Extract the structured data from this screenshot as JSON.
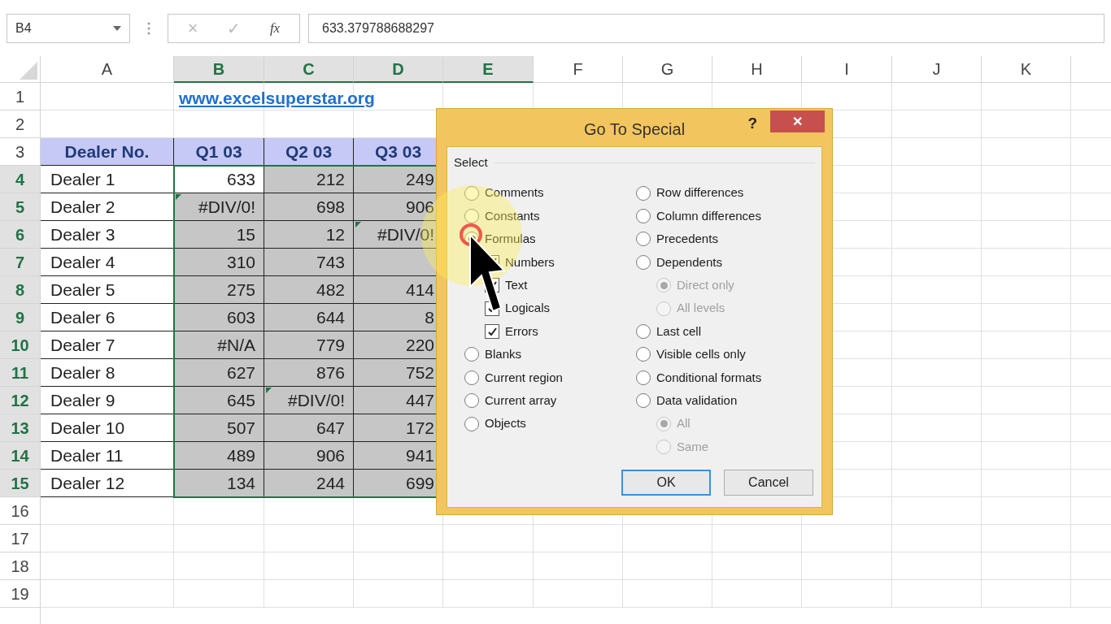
{
  "formula_bar": {
    "name_box": "B4",
    "cancel_icon": "×",
    "enter_icon": "✓",
    "function_icon": "fx",
    "formula": "633.379788688297"
  },
  "column_headers": [
    {
      "label": "A",
      "selected": false
    },
    {
      "label": "B",
      "selected": true
    },
    {
      "label": "C",
      "selected": true
    },
    {
      "label": "D",
      "selected": true
    },
    {
      "label": "E",
      "selected": true
    },
    {
      "label": "F",
      "selected": false
    },
    {
      "label": "G",
      "selected": false
    },
    {
      "label": "H",
      "selected": false
    },
    {
      "label": "I",
      "selected": false
    },
    {
      "label": "J",
      "selected": false
    },
    {
      "label": "K",
      "selected": false
    }
  ],
  "row_headers": [
    {
      "label": "1",
      "selected": false
    },
    {
      "label": "2",
      "selected": false
    },
    {
      "label": "3",
      "selected": false
    },
    {
      "label": "4",
      "selected": true
    },
    {
      "label": "5",
      "selected": true
    },
    {
      "label": "6",
      "selected": true
    },
    {
      "label": "7",
      "selected": true
    },
    {
      "label": "8",
      "selected": true
    },
    {
      "label": "9",
      "selected": true
    },
    {
      "label": "10",
      "selected": true
    },
    {
      "label": "11",
      "selected": true
    },
    {
      "label": "12",
      "selected": true
    },
    {
      "label": "13",
      "selected": true
    },
    {
      "label": "14",
      "selected": true
    },
    {
      "label": "15",
      "selected": true
    },
    {
      "label": "16",
      "selected": false
    },
    {
      "label": "17",
      "selected": false
    },
    {
      "label": "18",
      "selected": false
    },
    {
      "label": "19",
      "selected": false
    }
  ],
  "link": "www.excelsuperstar.org",
  "table": {
    "columns": [
      "Dealer No.",
      "Q1 03",
      "Q2 03",
      "Q3 03"
    ],
    "rows": [
      {
        "dealer": "Dealer 1",
        "values": [
          {
            "text": "633",
            "selected": false,
            "error_flag": false
          },
          {
            "text": "212",
            "selected": true,
            "error_flag": false
          },
          {
            "text": "249",
            "selected": true,
            "error_flag": false
          }
        ]
      },
      {
        "dealer": "Dealer 2",
        "values": [
          {
            "text": "#DIV/0!",
            "selected": true,
            "error_flag": true
          },
          {
            "text": "698",
            "selected": true,
            "error_flag": false
          },
          {
            "text": "906",
            "selected": true,
            "error_flag": false
          }
        ]
      },
      {
        "dealer": "Dealer 3",
        "values": [
          {
            "text": "15",
            "selected": true,
            "error_flag": false
          },
          {
            "text": "12",
            "selected": true,
            "error_flag": false
          },
          {
            "text": "#DIV/0!",
            "selected": true,
            "error_flag": true
          }
        ]
      },
      {
        "dealer": "Dealer 4",
        "values": [
          {
            "text": "310",
            "selected": true,
            "error_flag": false
          },
          {
            "text": "743",
            "selected": true,
            "error_flag": false
          },
          {
            "selected": true,
            "error_flag": false
          }
        ]
      },
      {
        "dealer": "Dealer 5",
        "values": [
          {
            "text": "275",
            "selected": true,
            "error_flag": false
          },
          {
            "text": "482",
            "selected": true,
            "error_flag": false
          },
          {
            "text": "414",
            "selected": true,
            "error_flag": false
          }
        ]
      },
      {
        "dealer": "Dealer 6",
        "values": [
          {
            "text": "603",
            "selected": true,
            "error_flag": false
          },
          {
            "text": "644",
            "selected": true,
            "error_flag": false
          },
          {
            "text": "8",
            "selected": true,
            "error_flag": false
          }
        ]
      },
      {
        "dealer": "Dealer 7",
        "values": [
          {
            "text": "#N/A",
            "selected": true,
            "error_flag": false
          },
          {
            "text": "779",
            "selected": true,
            "error_flag": false
          },
          {
            "text": "220",
            "selected": true,
            "error_flag": false
          }
        ]
      },
      {
        "dealer": "Dealer 8",
        "values": [
          {
            "text": "627",
            "selected": true,
            "error_flag": false
          },
          {
            "text": "876",
            "selected": true,
            "error_flag": false
          },
          {
            "text": "752",
            "selected": true,
            "error_flag": false
          }
        ]
      },
      {
        "dealer": "Dealer 9",
        "values": [
          {
            "text": "645",
            "selected": true,
            "error_flag": false
          },
          {
            "text": "#DIV/0!",
            "selected": true,
            "error_flag": true
          },
          {
            "text": "447",
            "selected": true,
            "error_flag": false
          }
        ]
      },
      {
        "dealer": "Dealer 10",
        "values": [
          {
            "text": "507",
            "selected": true,
            "error_flag": false
          },
          {
            "text": "647",
            "selected": true,
            "error_flag": false
          },
          {
            "text": "172",
            "selected": true,
            "error_flag": false
          }
        ]
      },
      {
        "dealer": "Dealer 11",
        "values": [
          {
            "text": "489",
            "selected": true,
            "error_flag": false
          },
          {
            "text": "906",
            "selected": true,
            "error_flag": false
          },
          {
            "text": "941",
            "selected": true,
            "error_flag": false
          }
        ]
      },
      {
        "dealer": "Dealer 12",
        "values": [
          {
            "text": "134",
            "selected": true,
            "error_flag": false
          },
          {
            "text": "244",
            "selected": true,
            "error_flag": false
          },
          {
            "text": "699",
            "selected": true,
            "error_flag": false
          }
        ]
      }
    ]
  },
  "dialog": {
    "title": "Go To Special",
    "help": "?",
    "close": "✕",
    "group_label": "Select",
    "left_options": [
      {
        "kind": "radio",
        "label": "Comments",
        "selected": false,
        "disabled": false
      },
      {
        "kind": "radio",
        "label": "Constants",
        "selected": false,
        "disabled": false
      },
      {
        "kind": "radio",
        "label": "Formulas",
        "selected": true,
        "disabled": false,
        "children": [
          {
            "kind": "checkbox",
            "label": "Numbers",
            "checked": true,
            "disabled": false
          },
          {
            "kind": "checkbox",
            "label": "Text",
            "checked": true,
            "disabled": false
          },
          {
            "kind": "checkbox",
            "label": "Logicals",
            "checked": true,
            "disabled": false
          },
          {
            "kind": "checkbox",
            "label": "Errors",
            "checked": true,
            "disabled": false
          }
        ]
      },
      {
        "kind": "radio",
        "label": "Blanks",
        "selected": false,
        "disabled": false
      },
      {
        "kind": "radio",
        "label": "Current region",
        "selected": false,
        "disabled": false
      },
      {
        "kind": "radio",
        "label": "Current array",
        "selected": false,
        "disabled": false
      },
      {
        "kind": "radio",
        "label": "Objects",
        "selected": false,
        "disabled": false
      }
    ],
    "right_options": [
      {
        "kind": "radio",
        "label": "Row differences",
        "selected": false,
        "disabled": false
      },
      {
        "kind": "radio",
        "label": "Column differences",
        "selected": false,
        "disabled": false
      },
      {
        "kind": "radio",
        "label": "Precedents",
        "selected": false,
        "disabled": false
      },
      {
        "kind": "radio",
        "label": "Dependents",
        "selected": false,
        "disabled": false,
        "children": [
          {
            "kind": "radio",
            "label": "Direct only",
            "selected": true,
            "disabled": true
          },
          {
            "kind": "radio",
            "label": "All levels",
            "selected": false,
            "disabled": true
          }
        ]
      },
      {
        "kind": "radio",
        "label": "Last cell",
        "selected": false,
        "disabled": false
      },
      {
        "kind": "radio",
        "label": "Visible cells only",
        "selected": false,
        "disabled": false
      },
      {
        "kind": "radio",
        "label": "Conditional formats",
        "selected": false,
        "disabled": false
      },
      {
        "kind": "radio",
        "label": "Data validation",
        "selected": false,
        "disabled": false,
        "children": [
          {
            "kind": "radio",
            "label": "All",
            "selected": true,
            "disabled": true
          },
          {
            "kind": "radio",
            "label": "Same",
            "selected": false,
            "disabled": true
          }
        ]
      }
    ],
    "buttons": [
      {
        "label": "OK",
        "default": true
      },
      {
        "label": "Cancel",
        "default": false
      }
    ]
  }
}
